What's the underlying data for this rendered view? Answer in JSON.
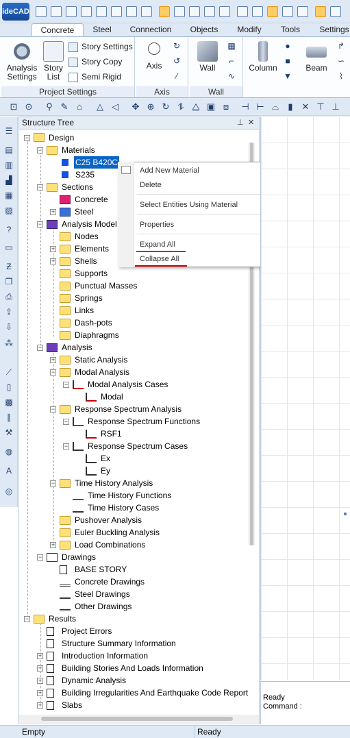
{
  "app": {
    "logo_text": "ideCAD"
  },
  "ribbon_tabs": [
    "Concrete",
    "Steel",
    "Connection",
    "Objects",
    "Modify",
    "Tools",
    "Settings"
  ],
  "ribbon": {
    "project_settings": {
      "caption": "Project Settings",
      "analysis_settings_label": "Analysis Settings",
      "story_list_label": "Story List",
      "story_settings_label": "Story Settings",
      "story_copy_label": "Story Copy",
      "semi_rigid_label": "Semi Rigid"
    },
    "axis": {
      "caption": "Axis",
      "axis_label": "Axis"
    },
    "wall": {
      "caption": "Wall",
      "wall_label": "Wall"
    },
    "other": {
      "column_label": "Column",
      "beam_label": "Beam"
    }
  },
  "panel": {
    "title": "Structure Tree",
    "pin_icon": "pin-icon",
    "close_label": "✕"
  },
  "tree": {
    "design": "Design",
    "materials": "Materials",
    "material_1": "C25 B420C",
    "material_2": "S235",
    "sections": "Sections",
    "concrete": "Concrete",
    "steel": "Steel",
    "analysis_model": "Analysis Model",
    "nodes": "Nodes",
    "elements": "Elements",
    "shells": "Shells",
    "supports": "Supports",
    "punctual_masses": "Punctual Masses",
    "springs": "Springs",
    "links": "Links",
    "dashpots": "Dash-pots",
    "diaphragms": "Diaphragms",
    "analysis": "Analysis",
    "static_analysis": "Static Analysis",
    "modal_analysis": "Modal Analysis",
    "modal_analysis_cases": "Modal Analysis Cases",
    "modal": "Modal",
    "rsa": "Response Spectrum Analysis",
    "rs_functions": "Response Spectrum Functions",
    "rsf1": "RSF1",
    "rs_cases": "Response Spectrum Cases",
    "ex": "Ex",
    "ey": "Ey",
    "tha": "Time History Analysis",
    "th_functions": "Time History Functions",
    "th_cases": "Time History Cases",
    "pushover": "Pushover Analysis",
    "euler": "Euler Buckling Analysis",
    "load_combinations": "Load Combinations",
    "drawings": "Drawings",
    "base_story": "BASE STORY",
    "concrete_drawings": "Concrete Drawings",
    "steel_drawings": "Steel Drawings",
    "other_drawings": "Other Drawings",
    "results": "Results",
    "project_errors": "Project Errors",
    "structure_summary": "Structure Summary Information",
    "introduction_info": "Introduction Information",
    "building_stories": "Building Stories And Loads Information",
    "dynamic_analysis": "Dynamic Analysis",
    "building_irregularities": "Building Irregularities And Earthquake Code Report",
    "slabs": "Slabs"
  },
  "context_menu": {
    "add_new_material": "Add New Material",
    "delete": "Delete",
    "select_entities": "Select Entities Using Material",
    "properties": "Properties",
    "expand_all": "Expand All",
    "collapse_all": "Collapse All"
  },
  "command": {
    "ready": "Ready",
    "command_label": "Command :"
  },
  "status": {
    "left": "Empty",
    "right": "Ready"
  },
  "colors": {
    "accent": "#0a64c8",
    "underline": "#e00000",
    "ribbon_bg": "#dfe9f5"
  }
}
